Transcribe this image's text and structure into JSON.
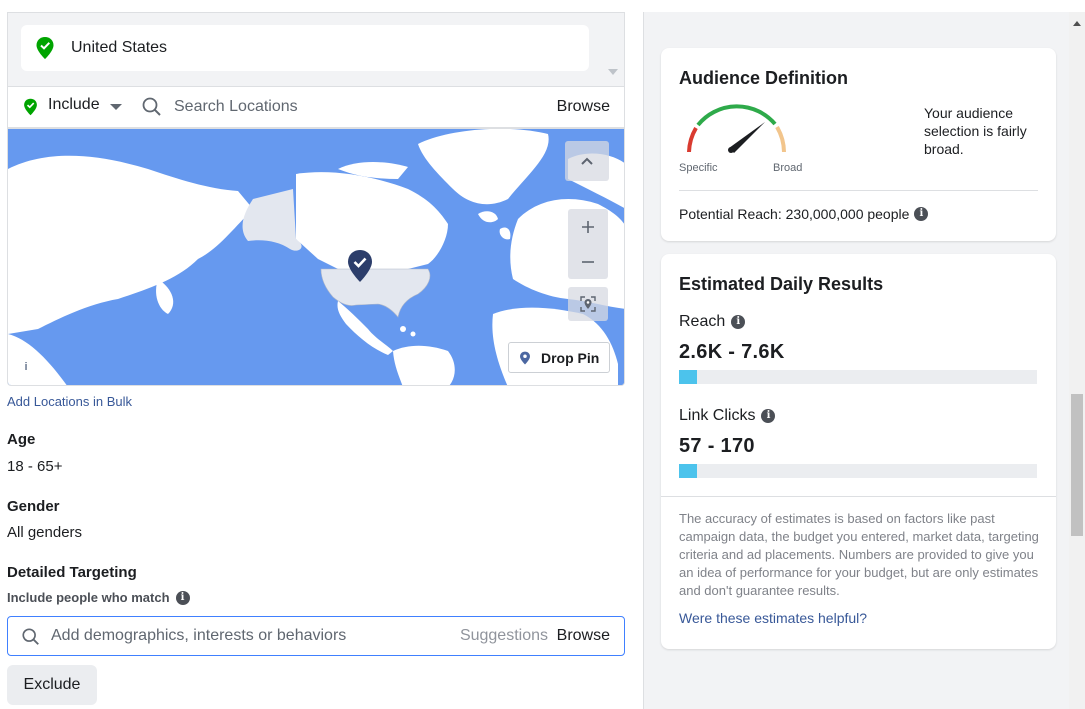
{
  "location": {
    "selected": "United States",
    "include_label": "Include",
    "search_placeholder": "Search Locations",
    "browse_label": "Browse",
    "drop_pin_label": "Drop Pin",
    "info_glyph": "i",
    "bulk_link": "Add Locations in Bulk"
  },
  "age": {
    "label": "Age",
    "value": "18 - 65+"
  },
  "gender": {
    "label": "Gender",
    "value": "All genders"
  },
  "detailed_targeting": {
    "label": "Detailed Targeting",
    "sub_label": "Include people who match",
    "placeholder": "Add demographics, interests or behaviors",
    "suggestions_label": "Suggestions",
    "browse_label": "Browse",
    "exclude_label": "Exclude"
  },
  "audience_definition": {
    "title": "Audience Definition",
    "gauge_left_label": "Specific",
    "gauge_right_label": "Broad",
    "description": "Your audience selection is fairly broad.",
    "potential_reach": "Potential Reach: 230,000,000 people"
  },
  "estimated_results": {
    "title": "Estimated Daily Results",
    "reach_label": "Reach",
    "reach_value": "2.6K - 7.6K",
    "reach_fill_fraction": 0.05,
    "clicks_label": "Link Clicks",
    "clicks_value": "57 - 170",
    "clicks_fill_fraction": 0.05,
    "disclaimer": "The accuracy of estimates is based on factors like past campaign data, the budget you entered, market data, targeting criteria and ad placements. Numbers are provided to give you an idea of performance for your budget, but are only estimates and don't guarantee results.",
    "helpful_link": "Were these estimates helpful?"
  },
  "colors": {
    "accent_blue": "#385898",
    "focus_blue": "#4080ff",
    "bar_fill": "#4cc3ec",
    "pin_green": "#42b72a"
  },
  "icons": [
    "location-pin-icon",
    "search-icon",
    "caret-down-icon",
    "chevron-up-icon",
    "plus-icon",
    "minus-icon",
    "locate-icon",
    "checkmark-pin-icon",
    "info-icon"
  ]
}
